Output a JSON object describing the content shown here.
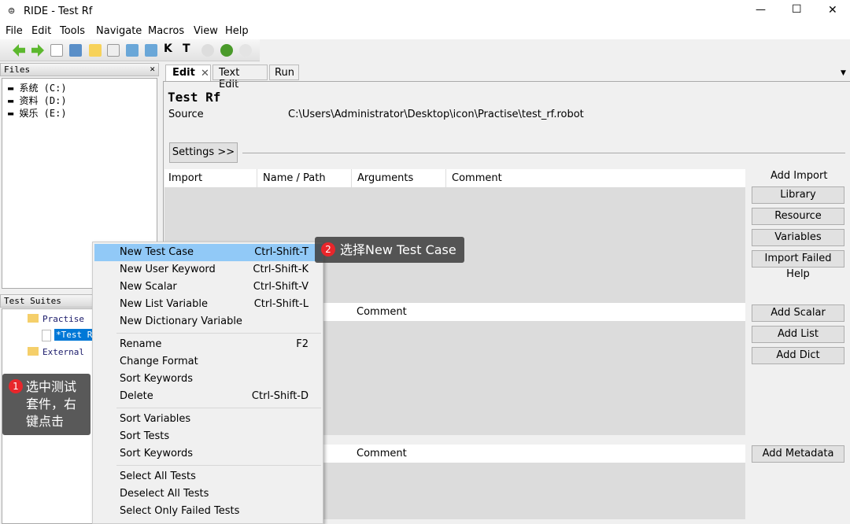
{
  "window": {
    "title": "RIDE - Test Rf",
    "minimize": "—",
    "maximize": "☐",
    "close": "✕"
  },
  "menubar": [
    "File",
    "Edit",
    "Tools",
    "Navigate",
    "Macros",
    "View",
    "Help"
  ],
  "files": {
    "header": "Files",
    "close": "✕",
    "drives": [
      "系统 (C:)",
      "资料 (D:)",
      "娱乐 (E:)"
    ]
  },
  "suites": {
    "header": "Test Suites",
    "tree": [
      "Practise",
      "*Test Rf",
      "External"
    ]
  },
  "tabs": [
    {
      "label": "Edit",
      "active": true
    },
    {
      "label": "Text Edit"
    },
    {
      "label": "Run"
    }
  ],
  "editor": {
    "title": "Test Rf",
    "source_label": "Source",
    "source_value": "C:\\Users\\Administrator\\Desktop\\icon\\Practise\\test_rf.robot",
    "settings_button": "Settings >>",
    "import_table": {
      "columns": [
        "Import",
        "Name / Path",
        "Arguments",
        "Comment"
      ]
    },
    "variable_table": {
      "columns": [
        "Comment"
      ]
    },
    "metadata_table": {
      "columns": [
        "Comment"
      ]
    },
    "import_label": "Add Import",
    "buttons": {
      "library": "Library",
      "resource": "Resource",
      "variables": "Variables",
      "import_failed": "Import Failed Help",
      "add_scalar": "Add Scalar",
      "add_list": "Add List",
      "add_dict": "Add Dict",
      "add_metadata": "Add Metadata"
    }
  },
  "context_menu": [
    {
      "label": "New Test Case",
      "shortcut": "Ctrl-Shift-T",
      "highlighted": true
    },
    {
      "label": "New User Keyword",
      "shortcut": "Ctrl-Shift-K"
    },
    {
      "label": "New Scalar",
      "shortcut": "Ctrl-Shift-V"
    },
    {
      "label": "New List Variable",
      "shortcut": "Ctrl-Shift-L"
    },
    {
      "label": "New Dictionary Variable",
      "shortcut": ""
    },
    {
      "label": "Rename",
      "shortcut": "F2"
    },
    {
      "label": "Change Format",
      "shortcut": ""
    },
    {
      "label": "Sort Keywords",
      "shortcut": ""
    },
    {
      "label": "Delete",
      "shortcut": "Ctrl-Shift-D"
    },
    {
      "label": "Sort Variables",
      "shortcut": ""
    },
    {
      "label": "Sort Tests",
      "shortcut": ""
    },
    {
      "label": "Sort Keywords",
      "shortcut": ""
    },
    {
      "label": "Select All Tests",
      "shortcut": ""
    },
    {
      "label": "Deselect All Tests",
      "shortcut": ""
    },
    {
      "label": "Select Only Failed Tests",
      "shortcut": ""
    }
  ],
  "annotations": [
    {
      "number": "1",
      "text": "选中测试套件，右键点击"
    },
    {
      "number": "2",
      "text": "选择New Test Case"
    }
  ],
  "colors": {
    "highlight": "#91c9f7",
    "selection": "#0078d7",
    "badge": "#e8262b"
  }
}
